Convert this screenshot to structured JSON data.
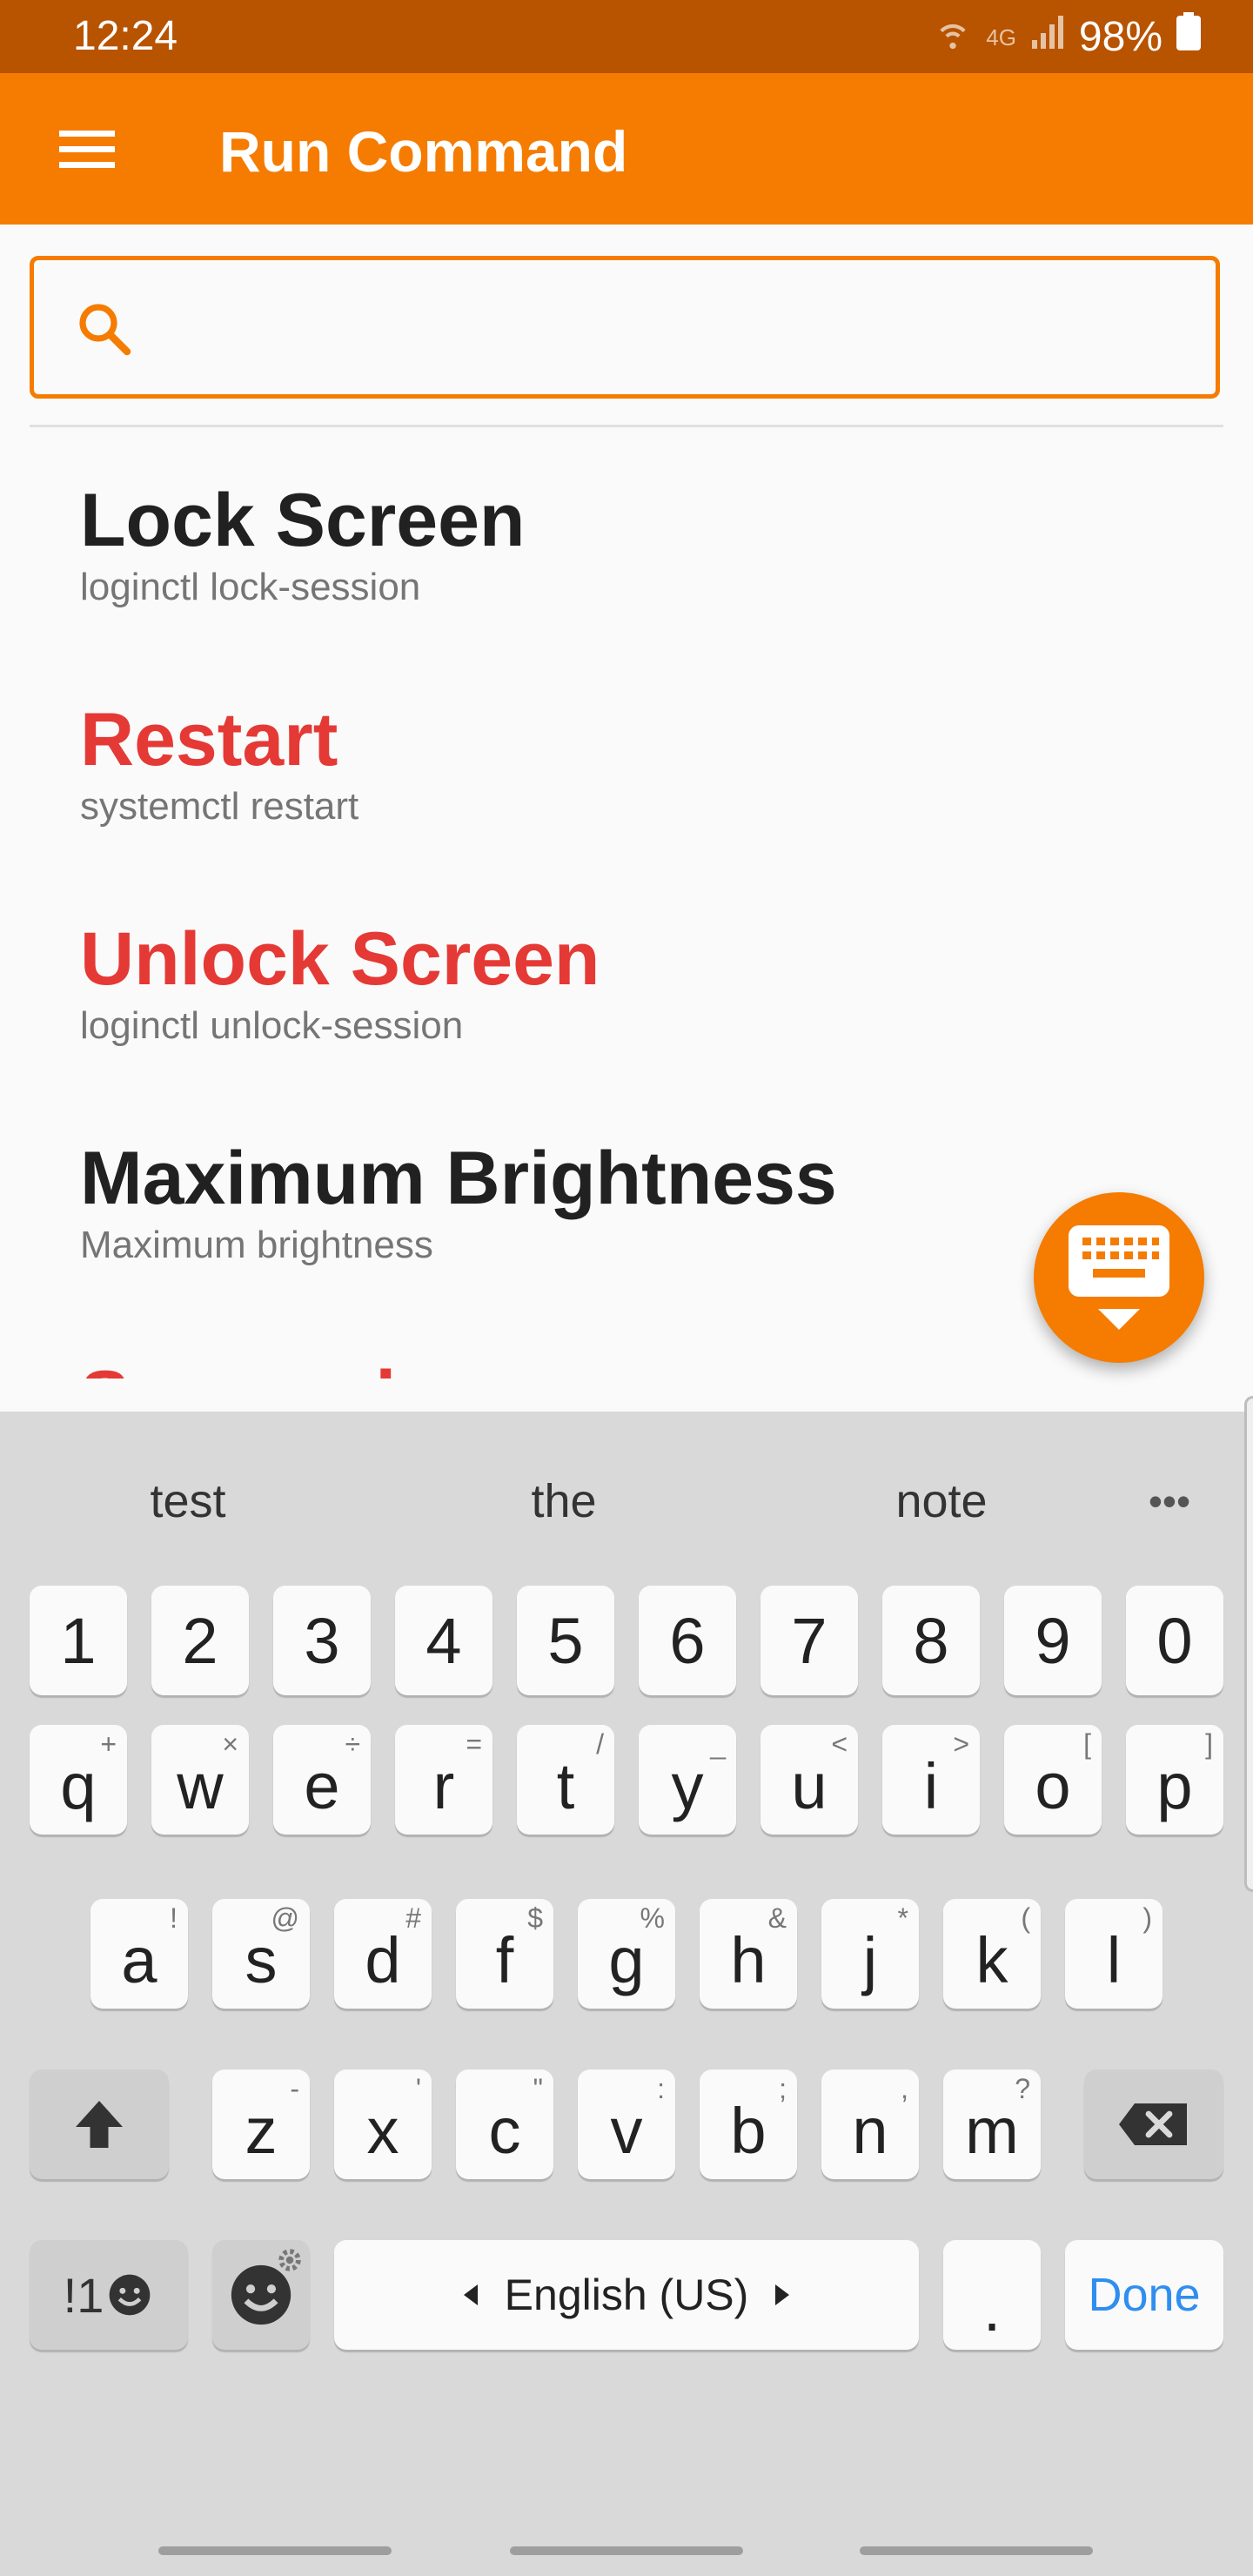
{
  "status_bar": {
    "time": "12:24",
    "network": "4G",
    "battery": "98%"
  },
  "app_bar": {
    "title": "Run Command",
    "menu_icon": "hamburger-menu-icon"
  },
  "search": {
    "value": "",
    "placeholder": "",
    "icon": "search-icon"
  },
  "commands": [
    {
      "title": "Lock Screen",
      "command": "loginctl lock-session",
      "color": "#212121"
    },
    {
      "title": "Restart",
      "command": "systemctl restart",
      "color": "#e53935"
    },
    {
      "title": "Unlock Screen",
      "command": "loginctl unlock-session",
      "color": "#e53935"
    },
    {
      "title": "Maximum Brightness",
      "command": "Maximum brightness",
      "color": "#212121"
    },
    {
      "title": "Suspend",
      "command": "",
      "color": "#e53935"
    }
  ],
  "fab": {
    "icon": "keyboard-icon"
  },
  "keyboard": {
    "suggestions": [
      "test",
      "the",
      "note"
    ],
    "more_icon": "more-horizontal-icon",
    "number_row": [
      "1",
      "2",
      "3",
      "4",
      "5",
      "6",
      "7",
      "8",
      "9",
      "0"
    ],
    "row1": [
      {
        "key": "q",
        "hint": "+"
      },
      {
        "key": "w",
        "hint": "×"
      },
      {
        "key": "e",
        "hint": "÷"
      },
      {
        "key": "r",
        "hint": "="
      },
      {
        "key": "t",
        "hint": "/"
      },
      {
        "key": "y",
        "hint": "_"
      },
      {
        "key": "u",
        "hint": "<"
      },
      {
        "key": "i",
        "hint": ">"
      },
      {
        "key": "o",
        "hint": "["
      },
      {
        "key": "p",
        "hint": "]"
      }
    ],
    "row2": [
      {
        "key": "a",
        "hint": "!"
      },
      {
        "key": "s",
        "hint": "@"
      },
      {
        "key": "d",
        "hint": "#"
      },
      {
        "key": "f",
        "hint": "$"
      },
      {
        "key": "g",
        "hint": "%"
      },
      {
        "key": "h",
        "hint": "&"
      },
      {
        "key": "j",
        "hint": "*"
      },
      {
        "key": "k",
        "hint": "("
      },
      {
        "key": "l",
        "hint": ")"
      }
    ],
    "row3": [
      {
        "key": "z",
        "hint": "-"
      },
      {
        "key": "x",
        "hint": "'"
      },
      {
        "key": "c",
        "hint": "\""
      },
      {
        "key": "v",
        "hint": ":"
      },
      {
        "key": "b",
        "hint": ";"
      },
      {
        "key": "n",
        "hint": ","
      },
      {
        "key": "m",
        "hint": "?"
      }
    ],
    "symbols_label": "!1",
    "space_label": "English (US)",
    "period": ".",
    "done_label": "Done",
    "accent_color": "#2f8ef0"
  }
}
